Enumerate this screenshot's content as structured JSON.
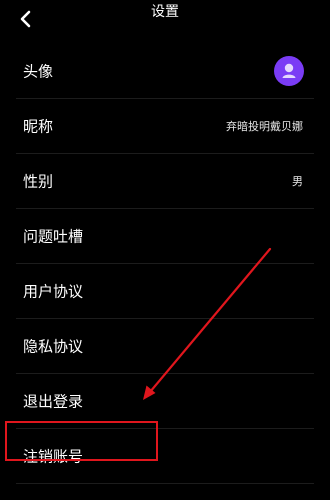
{
  "header": {
    "title": "设置"
  },
  "settings": {
    "items": [
      {
        "label": "头像",
        "value": ""
      },
      {
        "label": "昵称",
        "value": "弃暗投明戴贝娜"
      },
      {
        "label": "性别",
        "value": "男"
      },
      {
        "label": "问题吐槽",
        "value": ""
      },
      {
        "label": "用户协议",
        "value": ""
      },
      {
        "label": "隐私协议",
        "value": ""
      },
      {
        "label": "退出登录",
        "value": ""
      },
      {
        "label": "注销账号",
        "value": ""
      }
    ]
  },
  "colors": {
    "background": "#000000",
    "avatar": "#7a3cf5",
    "annotation": "#e0161d"
  }
}
